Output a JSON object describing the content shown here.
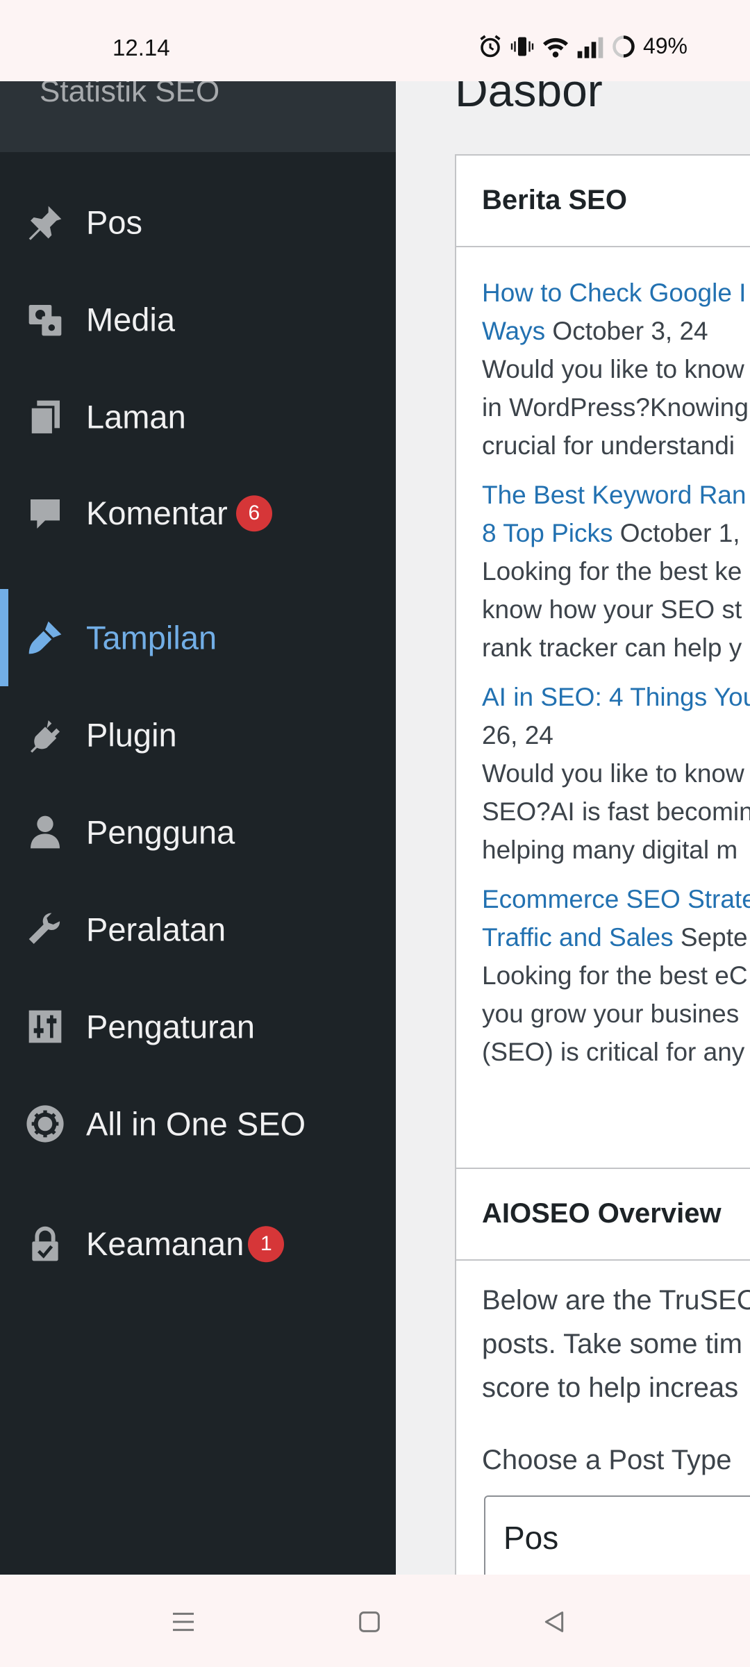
{
  "status_bar": {
    "time": "12.14",
    "battery": "49%"
  },
  "sidebar": {
    "header": "Statistik SEO",
    "items": [
      {
        "label": "Pos",
        "icon": "pin-icon"
      },
      {
        "label": "Media",
        "icon": "media-icon"
      },
      {
        "label": "Laman",
        "icon": "pages-icon"
      },
      {
        "label": "Komentar",
        "icon": "comment-icon",
        "badge": "6"
      },
      {
        "label": "Tampilan",
        "icon": "brush-icon",
        "active": true
      },
      {
        "label": "Plugin",
        "icon": "plugin-icon"
      },
      {
        "label": "Pengguna",
        "icon": "user-icon"
      },
      {
        "label": "Peralatan",
        "icon": "wrench-icon"
      },
      {
        "label": "Pengaturan",
        "icon": "settings-sliders-icon"
      },
      {
        "label": "All in One SEO",
        "icon": "aioseo-gear-icon"
      },
      {
        "label": "Keamanan",
        "icon": "lock-icon",
        "badge": "1"
      }
    ]
  },
  "main": {
    "title": "Dasbor",
    "news_card": {
      "title": "Berita SEO",
      "items": [
        {
          "link1": "How to Check Google I",
          "link2": "Ways",
          "date": " October 3, 24",
          "excerpt": [
            "Would you like to know",
            "in WordPress?Knowing",
            "crucial for understandi"
          ]
        },
        {
          "link1": "The Best Keyword Ran",
          "link2": "8 Top Picks",
          "date": " October 1,",
          "excerpt": [
            "Looking for the best ke",
            "know how your SEO st",
            "rank tracker can help y"
          ]
        },
        {
          "link1": "AI in SEO: 4 Things You",
          "link2": "",
          "date": "26, 24",
          "excerpt": [
            "Would you like to know",
            "SEO?AI is fast becomin",
            "helping many digital m"
          ]
        },
        {
          "link1": "Ecommerce SEO Strate",
          "link2": "Traffic and Sales",
          "date": " Septe",
          "excerpt": [
            "Looking for the best eC",
            "you grow your busines",
            "(SEO) is critical for any"
          ]
        }
      ]
    },
    "overview_card": {
      "title": "AIOSEO Overview",
      "text": [
        "Below are the TruSEO",
        "posts. Take some tim",
        "score to help increas"
      ],
      "post_type_label": "Choose a Post Type",
      "post_type_value": "Pos"
    }
  },
  "colors": {
    "sidebar_bg": "#1d2327",
    "accent": "#72aee6",
    "link": "#2271b1",
    "badge": "#d63638"
  }
}
